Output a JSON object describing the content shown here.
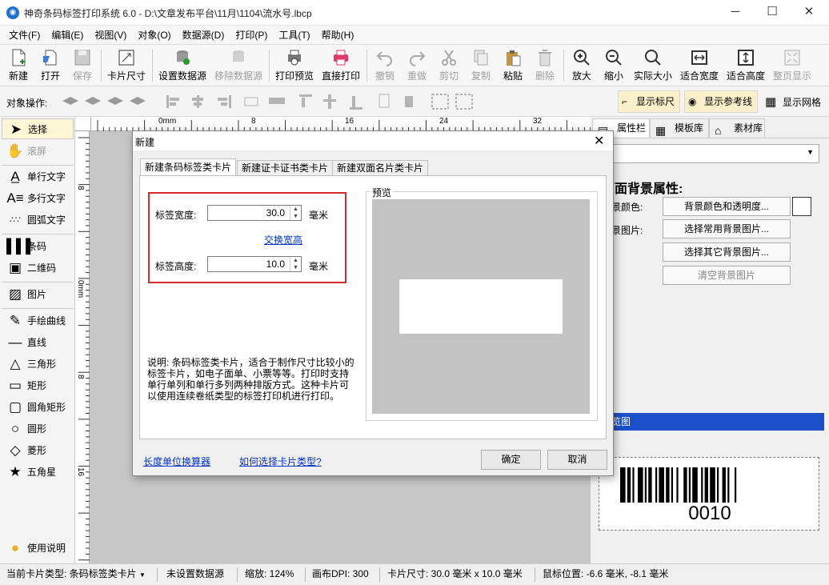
{
  "window": {
    "title": "神奇条码标签打印系统 6.0 - D:\\文章发布平台\\11月\\1104\\流水号.lbcp",
    "app_icon_glyph": "◉",
    "minimize": "─",
    "maximize": "☐",
    "close": "✕"
  },
  "menu": [
    "文件(F)",
    "编辑(E)",
    "视图(V)",
    "对象(O)",
    "数据源(D)",
    "打印(P)",
    "工具(T)",
    "帮助(H)"
  ],
  "toolbar": {
    "new": "新建",
    "open": "打开",
    "save": "保存",
    "card_size": "卡片尺寸",
    "set_datasource": "设置数据源",
    "remove_datasource": "移除数据源",
    "print_preview": "打印预览",
    "direct_print": "直接打印",
    "undo": "撤销",
    "redo": "重做",
    "cut": "剪切",
    "copy": "复制",
    "paste": "粘贴",
    "delete": "删除",
    "zoom_in": "放大",
    "zoom_out": "缩小",
    "actual_size": "实际大小",
    "fit_width": "适合宽度",
    "fit_height": "适合高度",
    "page_display": "整页显示"
  },
  "objbar": {
    "label": "对象操作:",
    "show_ruler": "显示标尺",
    "show_guides": "显示参考线",
    "show_grid": "显示网格"
  },
  "tools": {
    "select": "选择",
    "scroll": "滚屏",
    "single_text": "单行文字",
    "multi_text": "多行文字",
    "arc_text": "圆弧文字",
    "barcode": "条码",
    "qrcode": "二维码",
    "image": "图片",
    "freehand": "手绘曲线",
    "line": "直线",
    "triangle": "三角形",
    "rect": "矩形",
    "round_rect": "圆角矩形",
    "circle": "圆形",
    "diamond": "菱形",
    "star": "五角星",
    "help": "使用说明"
  },
  "ruler": {
    "h": [
      "0mm",
      "8",
      "16",
      "24",
      "32"
    ],
    "v": [
      "8",
      "0mm",
      "8",
      "16"
    ]
  },
  "right_panel": {
    "tabs": [
      "属性栏",
      "模板库",
      "素材库"
    ],
    "section_title": "页面背景属性:",
    "bg_color_label": "背景颜色:",
    "bg_image_label": "背景图片:",
    "btn_bg_color": "背景颜色和透明度...",
    "btn_common_bg": "选择常用背景图片...",
    "btn_other_bg": "选择其它背景图片...",
    "btn_clear_bg": "清空背景图片",
    "preview_header": "预览图",
    "barcode_text": "0010"
  },
  "status": {
    "card_type": "当前卡片类型: 条码标签类卡片",
    "datasource": "未设置数据源",
    "zoom": "缩放: 124%",
    "dpi": "画布DPI: 300",
    "card_size": "卡片尺寸: 30.0 毫米 x 10.0 毫米",
    "mouse": "鼠标位置: -6.6 毫米, -8.1 毫米"
  },
  "dialog": {
    "title": "新建",
    "tabs": [
      "新建条码标签类卡片",
      "新建证卡证书类卡片",
      "新建双面名片类卡片"
    ],
    "width_label": "标签宽度:",
    "width_value": "30.0",
    "unit": "毫米",
    "swap_link": "交换宽高",
    "height_label": "标签高度:",
    "height_value": "10.0",
    "preview_label": "预览",
    "preview_fraction_w": 0.75,
    "description": "说明: 条码标签类卡片，适合于制作尺寸比较小的标签卡片，如电子面单、小票等等。打印时支持单行单列和单行多列两种排版方式。这种卡片可以使用连续卷纸类型的标签打印机进行打印。",
    "link_calc": "长度单位换算器",
    "link_howto": "如何选择卡片类型?",
    "ok": "确定",
    "cancel": "取消"
  }
}
